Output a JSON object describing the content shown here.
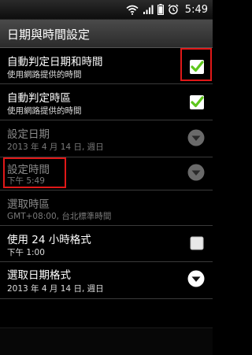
{
  "status_bar": {
    "time": "5:49"
  },
  "title_bar": {
    "title": "日期與時間設定"
  },
  "settings": [
    {
      "label": "自動判定日期和時間",
      "summary": "使用網路提供的時間",
      "control": "checkbox",
      "checked": true,
      "enabled": true,
      "highlighted": true
    },
    {
      "label": "自動判定時區",
      "summary": "使用網路提供的時間",
      "control": "checkbox",
      "checked": true,
      "enabled": true,
      "highlighted": false
    },
    {
      "label": "設定日期",
      "summary": "2013 年 4 月 14 日, 週日",
      "control": "dropdown",
      "enabled": false,
      "highlighted": false
    },
    {
      "label": "設定時間",
      "summary": "下午 5:49",
      "control": "dropdown",
      "enabled": false,
      "highlighted": true
    },
    {
      "label": "選取時區",
      "summary": "GMT+08:00, 台北標準時間",
      "control": "none",
      "enabled": false,
      "highlighted": false
    },
    {
      "label": "使用 24 小時格式",
      "summary": "下午 1:00",
      "control": "checkbox",
      "checked": false,
      "enabled": true,
      "highlighted": false
    },
    {
      "label": "選取日期格式",
      "summary": "2013 年 4 月 14 日, 週日",
      "control": "dropdown",
      "enabled": true,
      "highlighted": false
    }
  ],
  "colors": {
    "highlight": "#e01818",
    "check": "#5ec61c"
  }
}
